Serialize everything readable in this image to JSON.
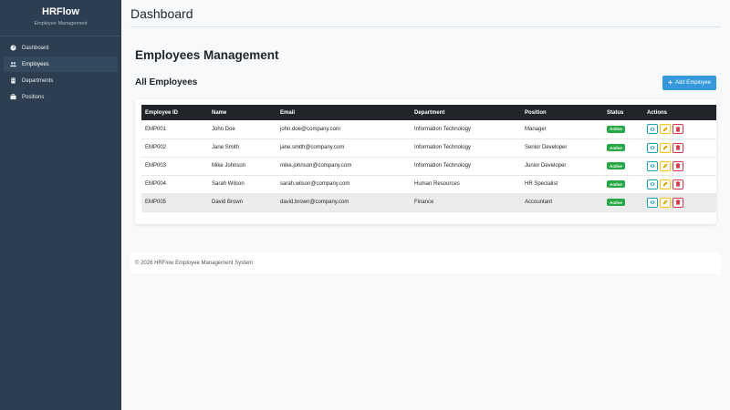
{
  "sidebar": {
    "brand_title": "HRFlow",
    "brand_subtitle": "Employee Management",
    "items": [
      {
        "label": "Dashboard",
        "icon": "dashboard-icon",
        "active": false
      },
      {
        "label": "Employees",
        "icon": "users-icon",
        "active": true
      },
      {
        "label": "Departments",
        "icon": "building-icon",
        "active": false
      },
      {
        "label": "Positions",
        "icon": "briefcase-icon",
        "active": false
      }
    ]
  },
  "topbar": {
    "title": "Dashboard"
  },
  "main": {
    "page_title": "Employees Management",
    "section_title": "All Employees",
    "add_button_label": "Add Employee"
  },
  "table": {
    "headers": [
      "Employee ID",
      "Name",
      "Email",
      "Department",
      "Position",
      "Status",
      "Actions"
    ],
    "rows": [
      {
        "id": "EMP001",
        "name": "John Doe",
        "email": "john.doe@company.com",
        "department": "Information Technology",
        "position": "Manager",
        "status": "Active"
      },
      {
        "id": "EMP002",
        "name": "Jane Smith",
        "email": "jane.smith@company.com",
        "department": "Information Technology",
        "position": "Senior Developer",
        "status": "Active"
      },
      {
        "id": "EMP003",
        "name": "Mike Johnson",
        "email": "mike.johnson@company.com",
        "department": "Information Technology",
        "position": "Junior Developer",
        "status": "Active"
      },
      {
        "id": "EMP004",
        "name": "Sarah Wilson",
        "email": "sarah.wilson@company.com",
        "department": "Human Resources",
        "position": "HR Specialist",
        "status": "Active"
      },
      {
        "id": "EMP005",
        "name": "David Brown",
        "email": "david.brown@company.com",
        "department": "Finance",
        "position": "Accountant",
        "status": "Active"
      }
    ]
  },
  "footer": {
    "text": "© 2026 HRFlow Employee Management System"
  },
  "colors": {
    "sidebar": "#2c3e50",
    "accent": "#3498db",
    "active_badge": "#28a745",
    "view": "#17a2b8",
    "edit": "#ffc107",
    "delete": "#dc3545"
  }
}
